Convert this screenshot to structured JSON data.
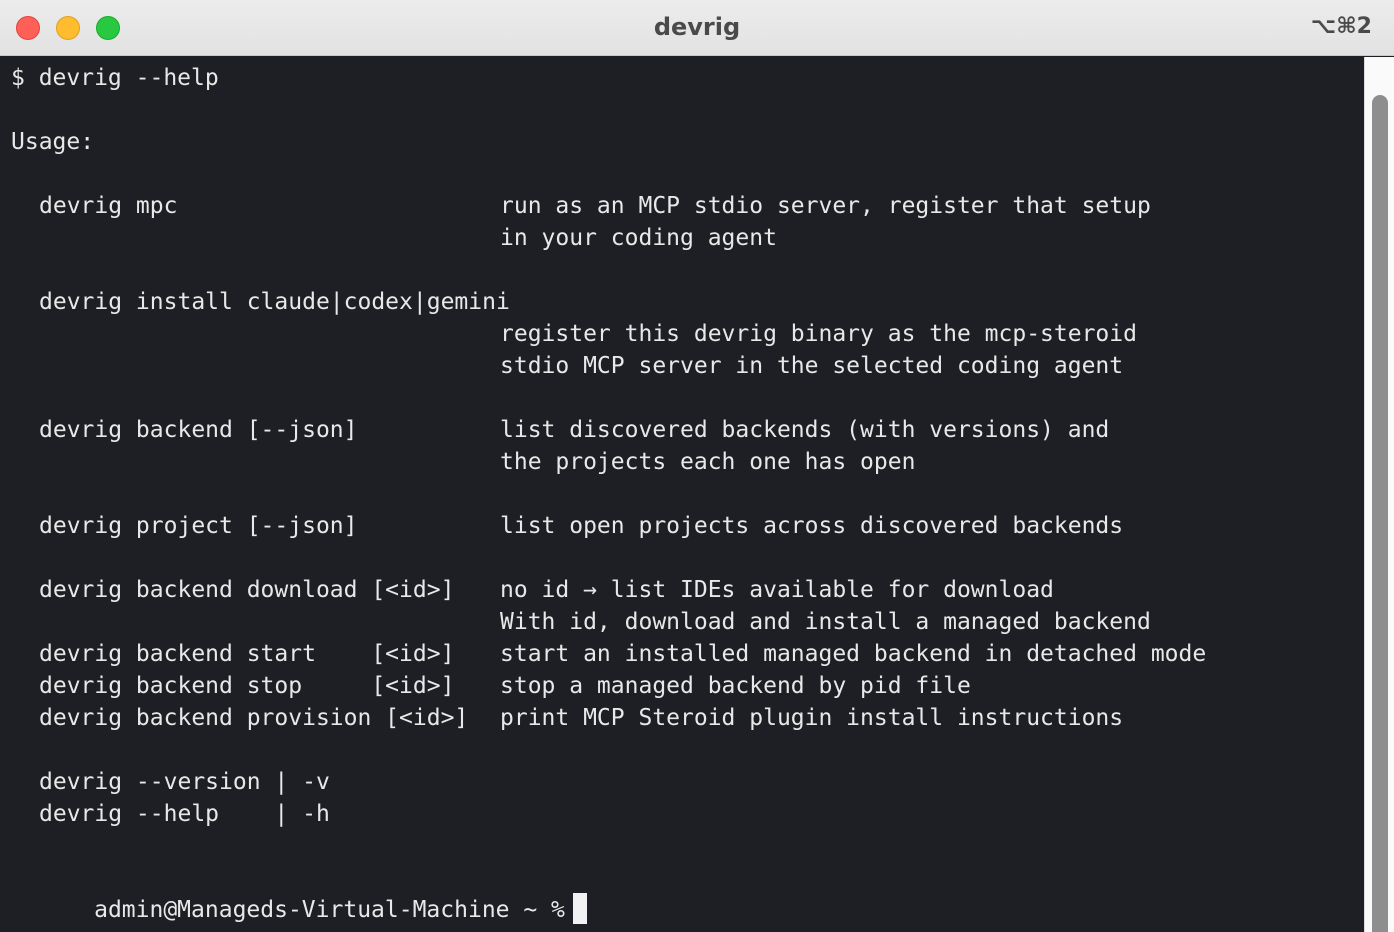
{
  "window": {
    "title": "devrig",
    "shortcut": "⌥⌘2"
  },
  "terminal": {
    "prompt_line": "$ devrig --help",
    "usage_heading": "Usage:",
    "commands": [
      {
        "cmd": "devrig mpc",
        "desc": [
          "run as an MCP stdio server, register that setup",
          "in your coding agent"
        ]
      },
      {
        "cmd": "devrig install claude|codex|gemini",
        "desc": [
          "register this devrig binary as the mcp-steroid",
          "stdio MCP server in the selected coding agent"
        ]
      },
      {
        "cmd": "devrig backend [--json]",
        "desc": [
          "list discovered backends (with versions) and",
          "the projects each one has open"
        ]
      },
      {
        "cmd": "devrig project [--json]",
        "desc": [
          "list open projects across discovered backends"
        ]
      },
      {
        "cmd": "devrig backend download [<id>]",
        "desc": [
          "no id → list IDEs available for download",
          "With id, download and install a managed backend"
        ]
      },
      {
        "cmd": "devrig backend start    [<id>]",
        "desc": [
          "start an installed managed backend in detached mode"
        ]
      },
      {
        "cmd": "devrig backend stop     [<id>]",
        "desc": [
          "stop a managed backend by pid file"
        ]
      },
      {
        "cmd": "devrig backend provision [<id>]",
        "desc": [
          "print MCP Steroid plugin install instructions"
        ]
      }
    ],
    "flags": [
      "devrig --version | -v",
      "devrig --help    | -h"
    ],
    "shell_prompt": "admin@Manageds-Virtual-Machine ~ %"
  }
}
